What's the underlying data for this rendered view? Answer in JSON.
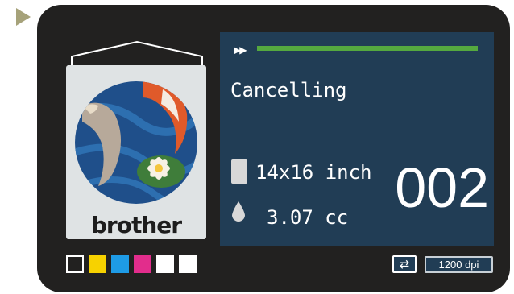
{
  "colors": {
    "screen_bg": "#213d55",
    "progress": "#55a93f",
    "device_bg": "#222120"
  },
  "icons": {
    "play": "play-triangle-icon",
    "fast_forward": "fast-forward-icon",
    "paper_size": "paper-sheet-icon",
    "ink": "ink-drop-icon",
    "swap": "swap-arrows-icon"
  },
  "artwork": {
    "brand": "brother"
  },
  "ink_slots": [
    {
      "name": "black",
      "color": "#222120",
      "outline": true
    },
    {
      "name": "yellow",
      "color": "#f7d200",
      "outline": false
    },
    {
      "name": "cyan",
      "color": "#1e9be6",
      "outline": false
    },
    {
      "name": "magenta",
      "color": "#e22d8c",
      "outline": false
    },
    {
      "name": "white-1",
      "color": "#ffffff",
      "outline": false
    },
    {
      "name": "white-2",
      "color": "#ffffff",
      "outline": false
    }
  ],
  "screen": {
    "fast_forward_glyph": "▶▶",
    "progress_fraction": 1.0,
    "status": "Cancelling",
    "size": "14x16 inch",
    "ink_usage": "3.07 cc",
    "copies": "002"
  },
  "footer": {
    "swap_glyph": "⇄",
    "dpi": "1200 dpi"
  }
}
